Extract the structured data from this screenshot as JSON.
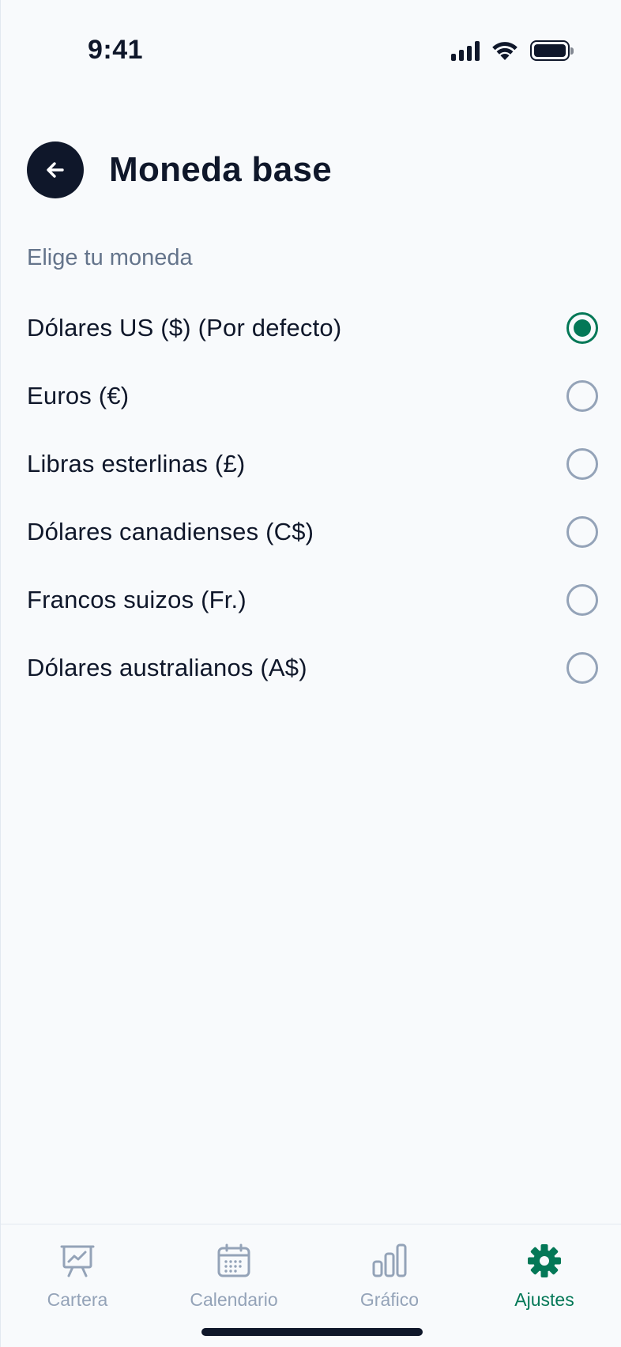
{
  "status_bar": {
    "time": "9:41"
  },
  "header": {
    "title": "Moneda base",
    "back_icon": "arrow-left-icon"
  },
  "section": {
    "label": "Elige tu moneda"
  },
  "currencies": [
    {
      "label": "Dólares US ($) (Por defecto)",
      "selected": true
    },
    {
      "label": "Euros (€)",
      "selected": false
    },
    {
      "label": "Libras esterlinas (£)",
      "selected": false
    },
    {
      "label": "Dólares canadienses (C$)",
      "selected": false
    },
    {
      "label": "Francos suizos (Fr.)",
      "selected": false
    },
    {
      "label": "Dólares australianos (A$)",
      "selected": false
    }
  ],
  "tabs": [
    {
      "label": "Cartera",
      "icon": "presentation-chart-icon",
      "active": false
    },
    {
      "label": "Calendario",
      "icon": "calendar-icon",
      "active": false
    },
    {
      "label": "Gráfico",
      "icon": "bar-chart-icon",
      "active": false
    },
    {
      "label": "Ajustes",
      "icon": "gear-icon",
      "active": true
    }
  ],
  "colors": {
    "accent": "#047857",
    "text": "#0f172a",
    "muted": "#64748b",
    "inactive": "#94a3b8",
    "background": "#f8fafc"
  }
}
